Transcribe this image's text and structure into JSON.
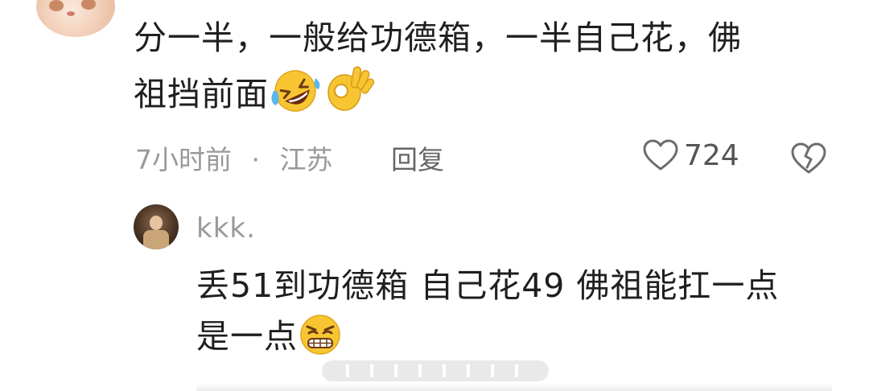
{
  "comment": {
    "text_line1": "分一半，一般给功德箱，一半自己花，佛",
    "text_line2": "祖挡前面",
    "emojis": [
      "rolling-laughing-emoji",
      "ok-hand-emoji"
    ],
    "time": "7小时前",
    "location": "江苏",
    "separator": "·",
    "reply_label": "回复",
    "like_count": "724"
  },
  "reply": {
    "username": "kkk.",
    "text_line1": "丢51到功德箱 自己花49 佛祖能扛一点",
    "text_line2": "是一点",
    "emojis": [
      "smirk-grin-emoji"
    ]
  },
  "colors": {
    "primary_text": "#1f1f1f",
    "secondary_text": "#999999",
    "emoji_yellow": "#f7c531"
  }
}
